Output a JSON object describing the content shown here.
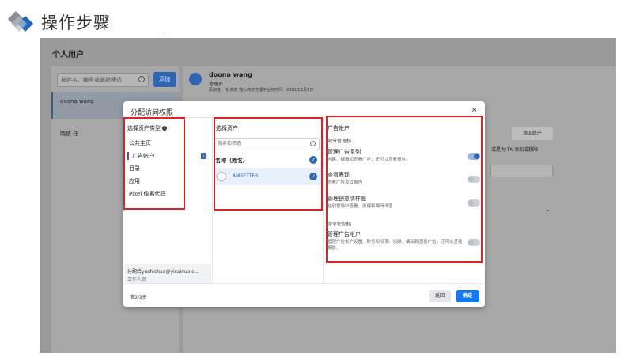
{
  "slide": {
    "title": "操作步骤"
  },
  "page": {
    "title": "个人用户"
  },
  "left_panel": {
    "search_placeholder": "按姓名、编号或邮箱筛选",
    "add_label": "添加",
    "users": [
      "doona wang",
      "晓依 任"
    ]
  },
  "user_detail": {
    "name": "doona wang",
    "role": "管理员",
    "meta": "添加者：任 晓依  加入商务管理平台的时间：2021年2月1日",
    "add_assets_label": "添加资产",
    "remove_hint": "或是为 TA 添加或移除"
  },
  "modal": {
    "title": "分配访问权限",
    "close": "×",
    "col1_header": "选择资产类型",
    "asset_types": [
      "公共主页",
      "广告帐户",
      "目录",
      "应用",
      "Pixel 像素代码"
    ],
    "selected_badge": "1",
    "assign_to": "分配给yushichao@yisainuo.c...",
    "assign_role": "工作人员",
    "col2_header": "选择资产",
    "asset_search_placeholder": "搜索和筛选",
    "col_name": "名称（姓名）",
    "assets": [
      "AMBETTER"
    ],
    "col3_header": "广告帐户",
    "partial_group": "部分管理权",
    "perms": [
      {
        "name": "管理广告系列",
        "desc": "创建、编辑和查看广告，还可以查看报告。",
        "on": true
      },
      {
        "name": "查看表现",
        "desc": "查看广告及其报告",
        "on": false
      },
      {
        "name": "管理创意情样图",
        "desc": "在创意情中查看、创建和编辑样图",
        "on": false
      }
    ],
    "full_group": "完全控制权",
    "full_perm": {
      "name": "管理广告帐户",
      "desc": "管理广告帐户设置、财务和权限。创建、编辑和查看广告，还可以查看报告。",
      "on": false
    },
    "step": "第2/3步",
    "back": "返回",
    "confirm": "确定"
  },
  "colors": {
    "accent": "#1877f2",
    "highlight": "#d9242a"
  }
}
